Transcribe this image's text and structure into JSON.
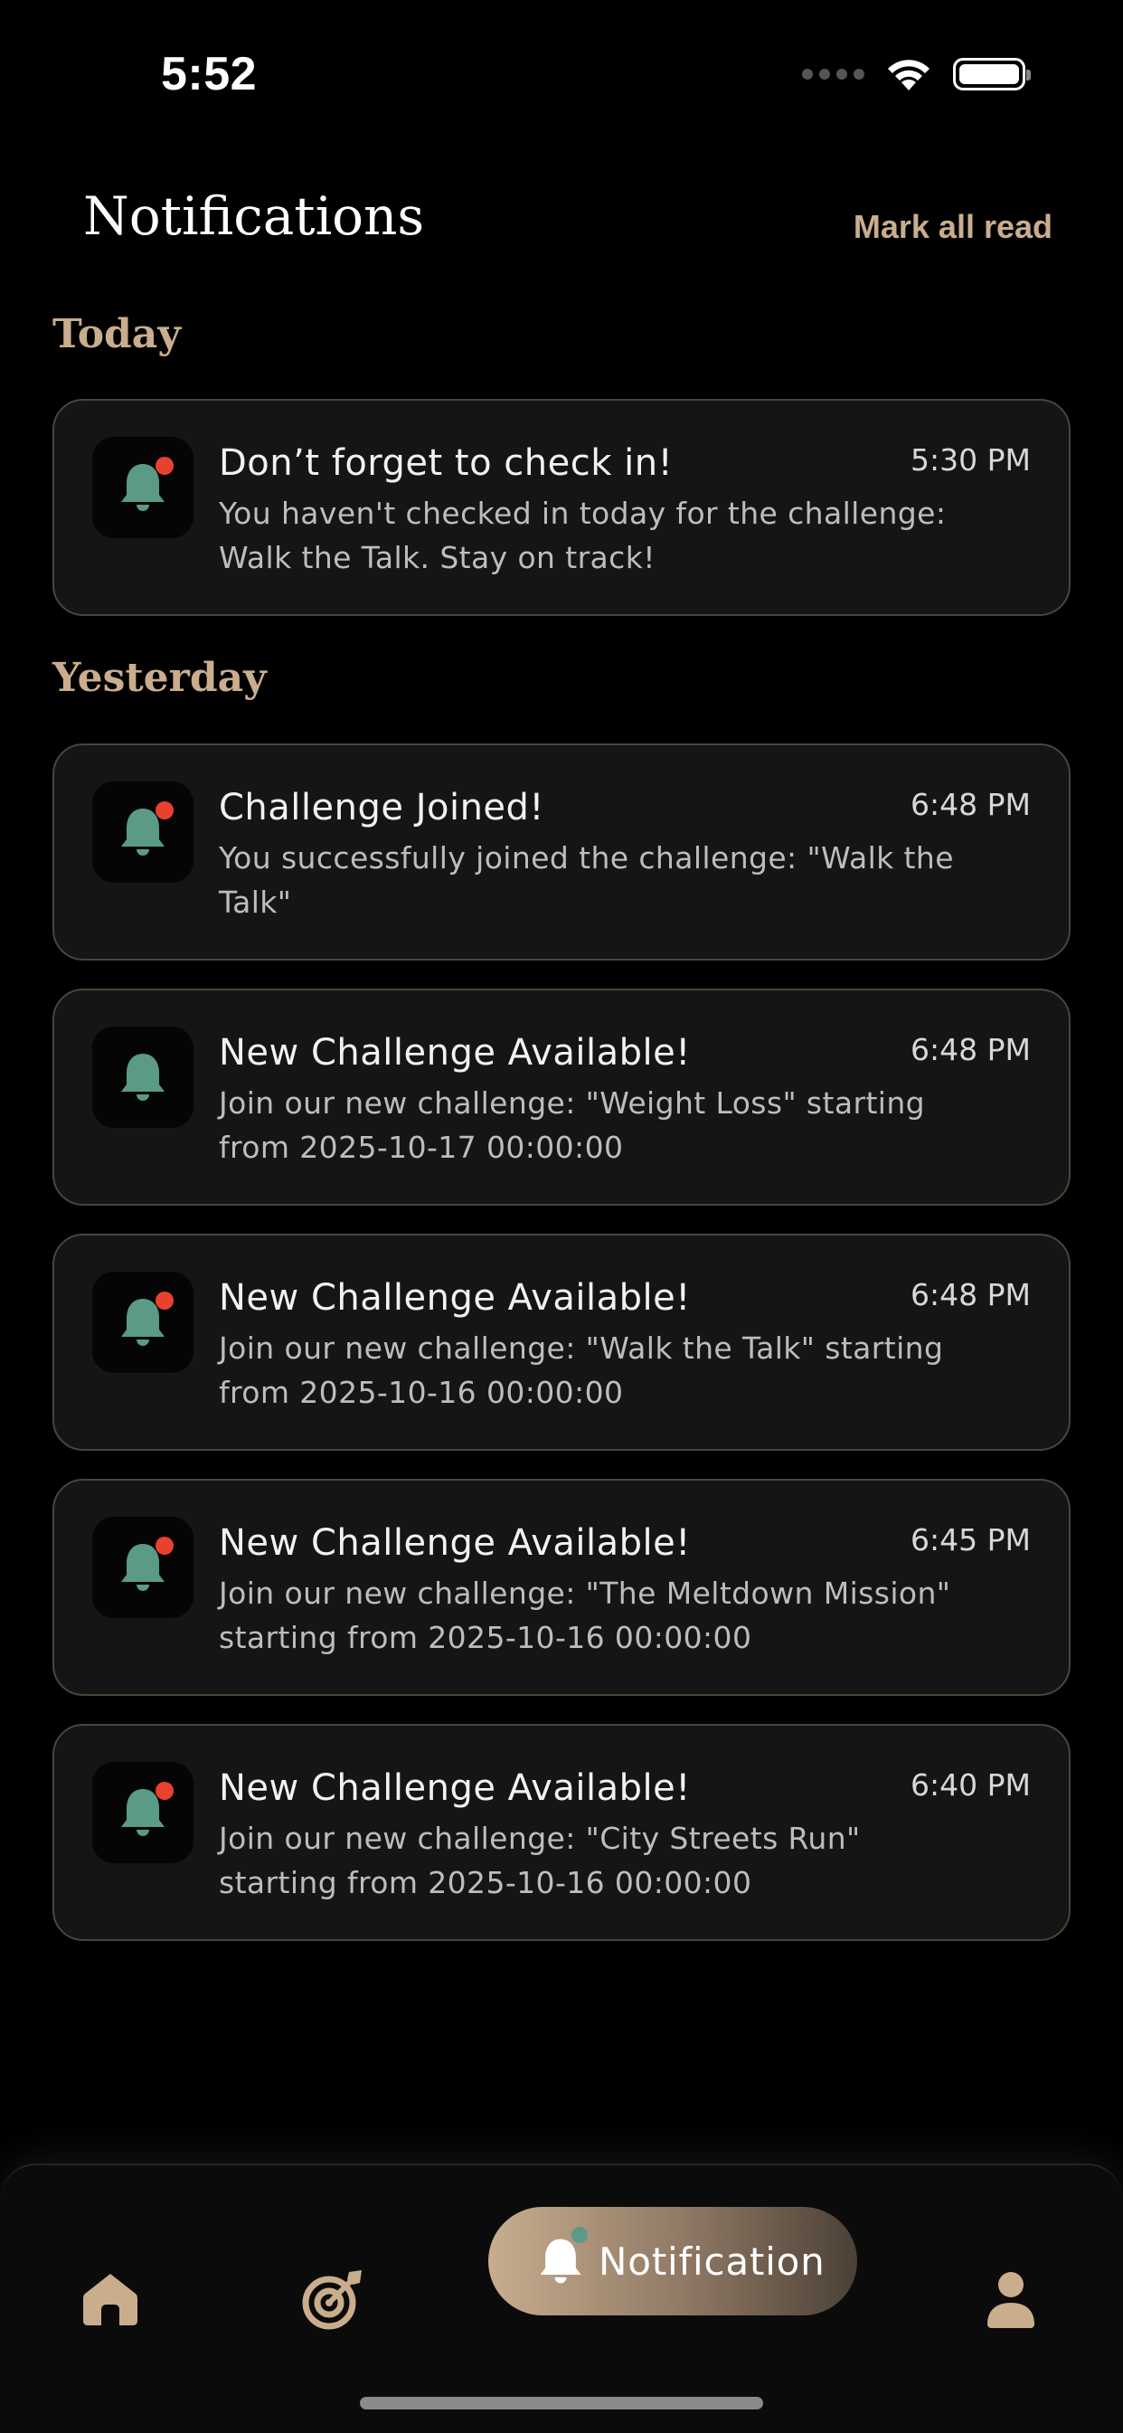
{
  "status_bar": {
    "time": "5:52"
  },
  "header": {
    "title": "Notifications",
    "mark_all_read": "Mark all read"
  },
  "sections": [
    {
      "label": "Today",
      "items": [
        {
          "title": "Don’t forget to check in!",
          "body": "You haven't checked in today for the challenge: Walk the Talk. Stay on track!",
          "time": "5:30 PM",
          "unread": true
        }
      ]
    },
    {
      "label": "Yesterday",
      "items": [
        {
          "title": "Challenge Joined!",
          "body": "You successfully joined the challenge: \"Walk the Talk\"",
          "time": "6:48 PM",
          "unread": true
        },
        {
          "title": "New Challenge Available!",
          "body": "Join our new challenge: \"Weight Loss\" starting from 2025-10-17 00:00:00",
          "time": "6:48 PM",
          "unread": false
        },
        {
          "title": "New Challenge Available!",
          "body": "Join our new challenge: \"Walk the Talk\" starting from 2025-10-16 00:00:00",
          "time": "6:48 PM",
          "unread": true
        },
        {
          "title": "New Challenge Available!",
          "body": "Join our new challenge: \"The Meltdown Mission\" starting from 2025-10-16 00:00:00",
          "time": "6:45 PM",
          "unread": true
        },
        {
          "title": "New Challenge Available!",
          "body": "Join our new challenge: \"City Streets Run\" starting from 2025-10-16 00:00:00",
          "time": "6:40 PM",
          "unread": true
        }
      ]
    }
  ],
  "bottom_nav": {
    "items": [
      {
        "icon": "home-icon",
        "label": ""
      },
      {
        "icon": "target-icon",
        "label": ""
      },
      {
        "icon": "bell-icon",
        "label": "Notification",
        "active": true
      },
      {
        "icon": "profile-icon",
        "label": ""
      }
    ]
  },
  "colors": {
    "background": "#000000",
    "card_background": "#151515",
    "card_border": "#4d4438",
    "accent_gold": "#c9ad8d",
    "bell_green": "#5a9a87",
    "unread_dot": "#e8412f"
  }
}
